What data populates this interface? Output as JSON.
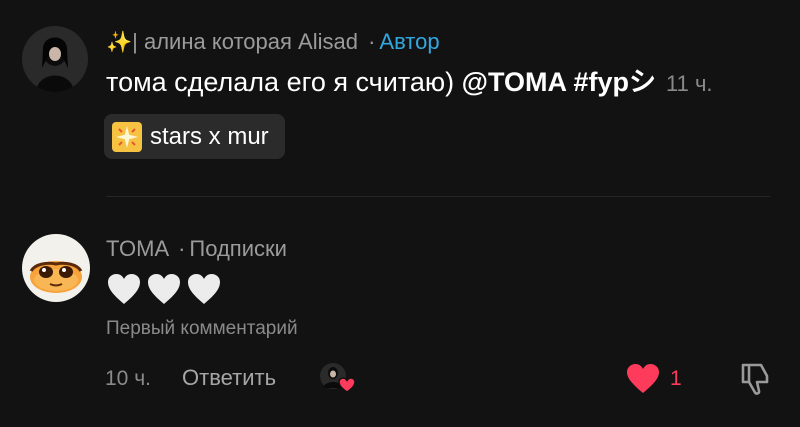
{
  "author_comment": {
    "prefix_icon": "sparkles-icon",
    "username": "| алина которая Alisad",
    "separator": "·",
    "author_tag": "Автор",
    "text": "тома сделала его я считаю)",
    "mention": "@TOMA #fypシ",
    "time": "11 ч.",
    "music": {
      "icon": "sparkle-square-icon",
      "label": "stars x mur"
    }
  },
  "reply_comment": {
    "username": "TOMA",
    "separator": "·",
    "relation": "Подписки",
    "hearts_icon": "white-heart-icon",
    "hearts_count": 3,
    "note": "Первый комментарий",
    "time": "10 ч.",
    "reply_label": "Ответить",
    "like_count": "1"
  },
  "colors": {
    "background": "#121212",
    "author_tag": "#33a7e0",
    "like": "#ff3b5c",
    "muted_text": "#8a8a8a",
    "chip_bg": "#2b2b2b"
  }
}
